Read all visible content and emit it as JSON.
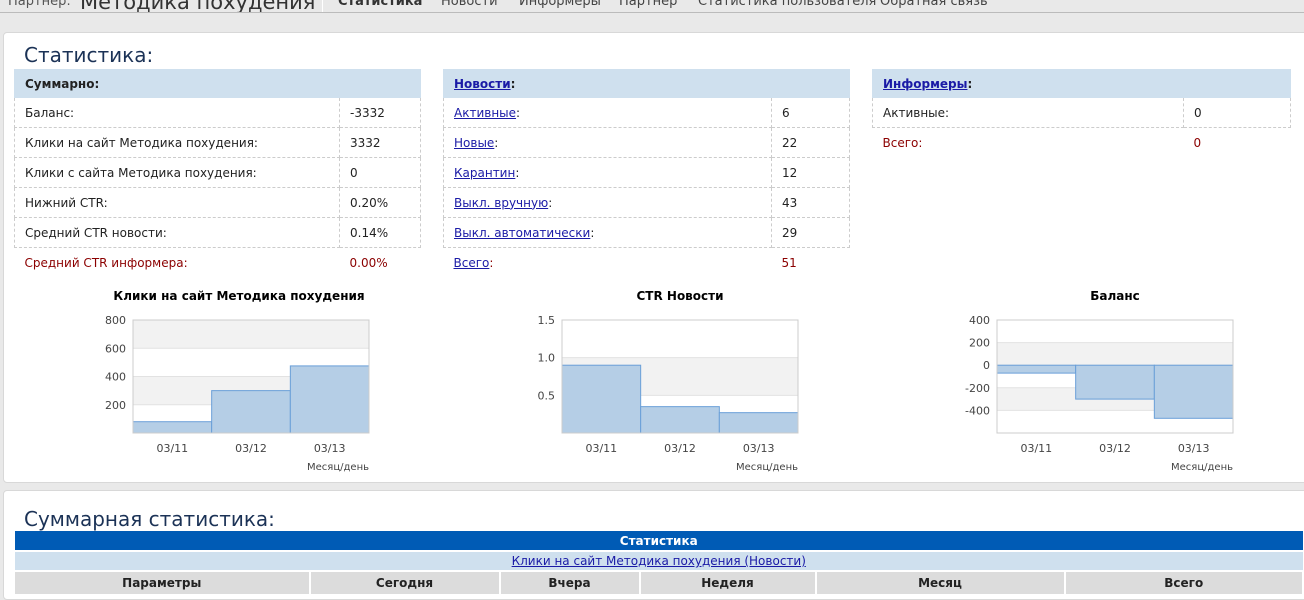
{
  "topbar": {
    "partner_label": "Партнер:",
    "partner_name": "Методика похудения",
    "nav": [
      {
        "label": "Статистика",
        "active": true
      },
      {
        "label": "Новости"
      },
      {
        "label": "Информеры"
      },
      {
        "label": "Партнер"
      },
      {
        "label": "Статистика пользователя"
      },
      {
        "label": "Обратная связь"
      }
    ]
  },
  "stats": {
    "title": "Статистика:",
    "summary": {
      "header": "Суммарно:",
      "rows": [
        [
          "Баланс:",
          "-3332"
        ],
        [
          "Клики на сайт Методика похудения:",
          "3332"
        ],
        [
          "Клики с сайта Методика похудения:",
          "0"
        ],
        [
          "Нижний CTR:",
          "0.20%"
        ],
        [
          "Средний CTR новости:",
          "0.14%"
        ]
      ],
      "total": [
        "Средний CTR информера:",
        "0.00%"
      ]
    },
    "news": {
      "header": "Новости",
      "rows": [
        [
          "Активные",
          "6"
        ],
        [
          "Новые",
          "22"
        ],
        [
          "Карантин",
          "12"
        ],
        [
          "Выкл. вручную",
          "43"
        ],
        [
          "Выкл. автоматически",
          "29"
        ]
      ],
      "total": [
        "Всего",
        "51"
      ]
    },
    "informers": {
      "header": "Информеры",
      "rows": [
        [
          "Активные:",
          "0"
        ]
      ],
      "total": [
        "Всего:",
        "0"
      ]
    }
  },
  "chart_data": [
    {
      "type": "bar",
      "title": "Клики на сайт Методика похудения",
      "categories": [
        "03/11",
        "03/12",
        "03/13"
      ],
      "values": [
        80,
        300,
        475
      ],
      "xlabel": "Месяц/день",
      "ylim": [
        0,
        800
      ],
      "yticks": [
        200,
        400,
        600,
        800
      ],
      "tick_labels": [
        "200",
        "400",
        "600",
        "800"
      ],
      "grid": true
    },
    {
      "type": "bar",
      "title": "CTR Новости",
      "categories": [
        "03/11",
        "03/12",
        "03/13"
      ],
      "values": [
        0.9,
        0.35,
        0.27
      ],
      "xlabel": "Месяц/день",
      "ylim": [
        0,
        1.5
      ],
      "yticks": [
        0.5,
        1.0,
        1.5
      ],
      "tick_labels": [
        "0.5",
        "1.0",
        "1.5"
      ],
      "grid": true
    },
    {
      "type": "bar",
      "title": "Баланс",
      "categories": [
        "03/11",
        "03/12",
        "03/13"
      ],
      "values": [
        -70,
        -300,
        -470
      ],
      "xlabel": "Месяц/день",
      "ylim": [
        -600,
        400
      ],
      "yticks": [
        -400,
        -200,
        0,
        200,
        400
      ],
      "tick_labels": [
        "-400",
        "-200",
        "0",
        "200",
        "400"
      ],
      "grid": true
    }
  ],
  "colors": {
    "bar_fill": "#b5cee6",
    "bar_stroke": "#6a9fd8",
    "header_blue": "#005bb5",
    "light_blue": "#cfe0ee",
    "total_red": "#8b0000"
  },
  "summary_stats": {
    "title": "Суммарная статистика:",
    "table_title": "Статистика",
    "section_link": "Клики на сайт Методика похудения (Новости)",
    "columns": [
      "Параметры",
      "Сегодня",
      "Вчера",
      "Неделя",
      "Месяц",
      "Всего"
    ]
  }
}
